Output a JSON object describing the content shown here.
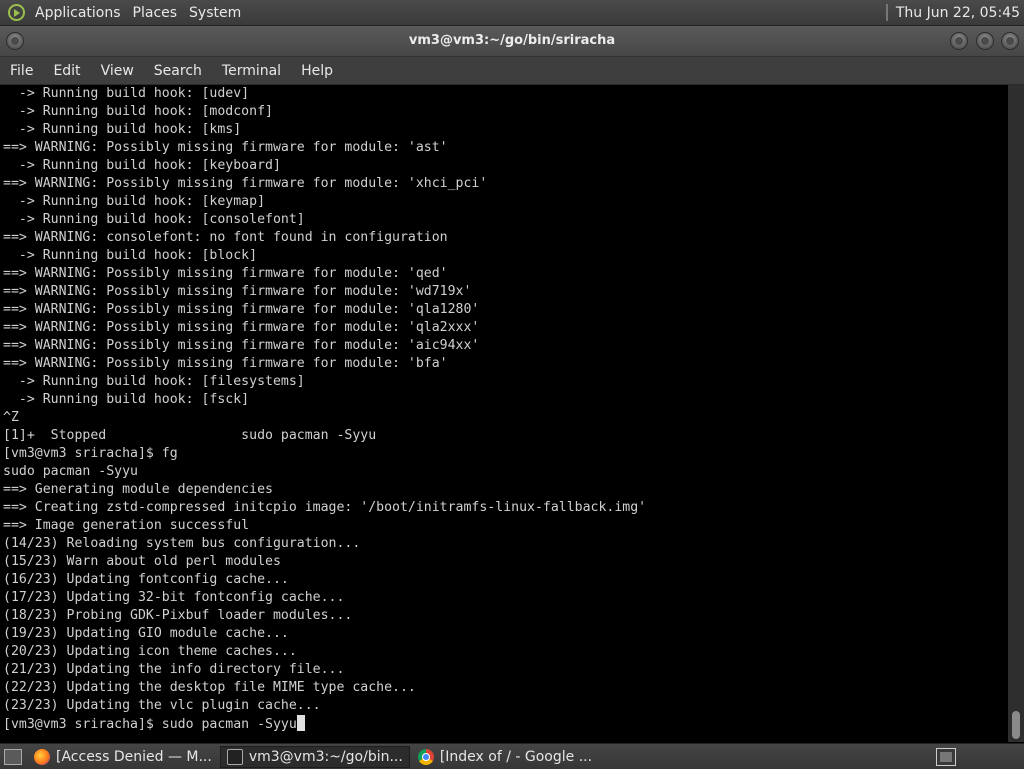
{
  "top_panel": {
    "menus": [
      "Applications",
      "Places",
      "System"
    ],
    "clock": "Thu Jun 22, 05:45"
  },
  "window": {
    "title": "vm3@vm3:~/go/bin/sriracha",
    "menu": [
      "File",
      "Edit",
      "View",
      "Search",
      "Terminal",
      "Help"
    ]
  },
  "terminal": {
    "lines": [
      "  -> Running build hook: [udev]",
      "  -> Running build hook: [modconf]",
      "  -> Running build hook: [kms]",
      "==> WARNING: Possibly missing firmware for module: 'ast'",
      "  -> Running build hook: [keyboard]",
      "==> WARNING: Possibly missing firmware for module: 'xhci_pci'",
      "  -> Running build hook: [keymap]",
      "  -> Running build hook: [consolefont]",
      "==> WARNING: consolefont: no font found in configuration",
      "  -> Running build hook: [block]",
      "==> WARNING: Possibly missing firmware for module: 'qed'",
      "==> WARNING: Possibly missing firmware for module: 'wd719x'",
      "==> WARNING: Possibly missing firmware for module: 'qla1280'",
      "==> WARNING: Possibly missing firmware for module: 'qla2xxx'",
      "==> WARNING: Possibly missing firmware for module: 'aic94xx'",
      "==> WARNING: Possibly missing firmware for module: 'bfa'",
      "  -> Running build hook: [filesystems]",
      "  -> Running build hook: [fsck]",
      "^Z",
      "[1]+  Stopped                 sudo pacman -Syyu",
      "[vm3@vm3 sriracha]$ fg",
      "sudo pacman -Syyu",
      "==> Generating module dependencies",
      "==> Creating zstd-compressed initcpio image: '/boot/initramfs-linux-fallback.img'",
      "==> Image generation successful",
      "(14/23) Reloading system bus configuration...",
      "(15/23) Warn about old perl modules",
      "(16/23) Updating fontconfig cache...",
      "(17/23) Updating 32-bit fontconfig cache...",
      "(18/23) Probing GDK-Pixbuf loader modules...",
      "(19/23) Updating GIO module cache...",
      "(20/23) Updating icon theme caches...",
      "(21/23) Updating the info directory file...",
      "(22/23) Updating the desktop file MIME type cache...",
      "(23/23) Updating the vlc plugin cache..."
    ],
    "prompt": "[vm3@vm3 sriracha]$ sudo pacman -Syyu"
  },
  "taskbar": {
    "tasks": [
      {
        "label": "[Access Denied — M...",
        "icon": "firefox-icon"
      },
      {
        "label": "vm3@vm3:~/go/bin...",
        "icon": "terminal-icon"
      },
      {
        "label": "[Index of / - Google ...",
        "icon": "chrome-icon"
      }
    ]
  }
}
